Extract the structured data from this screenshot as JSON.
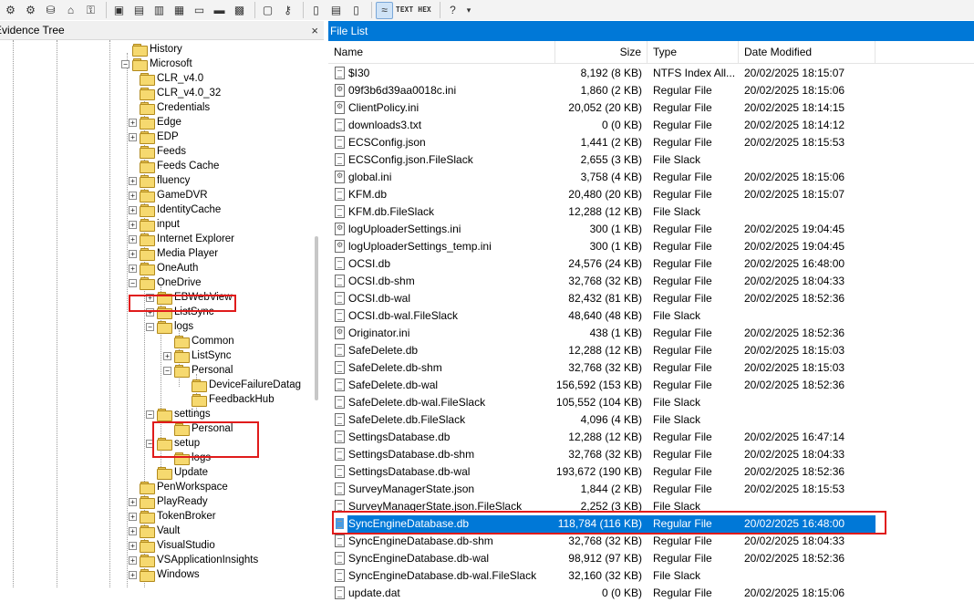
{
  "toolbar": {
    "buttons": [
      "add-evidence",
      "add-all-evidence",
      "create-disk-image",
      "export-files",
      "decrypt",
      "acquire",
      "save",
      "save-all",
      "capture-memory",
      "verify",
      "print",
      "options",
      "report",
      "find",
      "search",
      "new",
      "properties",
      "open",
      "view-natural",
      "view-text",
      "view-hex",
      "help",
      "more"
    ],
    "text_label": "TEXT",
    "hex_label": "HEX"
  },
  "evidence_tree": {
    "title": "Evidence Tree",
    "close": "×",
    "items": [
      {
        "label": "History",
        "level": 0,
        "exp": ""
      },
      {
        "label": "Microsoft",
        "level": 0,
        "exp": "-"
      },
      {
        "label": "CLR_v4.0",
        "level": 1,
        "exp": ""
      },
      {
        "label": "CLR_v4.0_32",
        "level": 1,
        "exp": ""
      },
      {
        "label": "Credentials",
        "level": 1,
        "exp": ""
      },
      {
        "label": "Edge",
        "level": 1,
        "exp": "+"
      },
      {
        "label": "EDP",
        "level": 1,
        "exp": "+"
      },
      {
        "label": "Feeds",
        "level": 1,
        "exp": ""
      },
      {
        "label": "Feeds Cache",
        "level": 1,
        "exp": ""
      },
      {
        "label": "fluency",
        "level": 1,
        "exp": "+"
      },
      {
        "label": "GameDVR",
        "level": 1,
        "exp": "+"
      },
      {
        "label": "IdentityCache",
        "level": 1,
        "exp": "+"
      },
      {
        "label": "input",
        "level": 1,
        "exp": "+"
      },
      {
        "label": "Internet Explorer",
        "level": 1,
        "exp": "+"
      },
      {
        "label": "Media Player",
        "level": 1,
        "exp": "+"
      },
      {
        "label": "OneAuth",
        "level": 1,
        "exp": "+"
      },
      {
        "label": "OneDrive",
        "level": 1,
        "exp": "-"
      },
      {
        "label": "EBWebView",
        "level": 2,
        "exp": "+"
      },
      {
        "label": "ListSync",
        "level": 2,
        "exp": "+"
      },
      {
        "label": "logs",
        "level": 2,
        "exp": "-"
      },
      {
        "label": "Common",
        "level": 3,
        "exp": ""
      },
      {
        "label": "ListSync",
        "level": 3,
        "exp": "+"
      },
      {
        "label": "Personal",
        "level": 3,
        "exp": "-"
      },
      {
        "label": "DeviceFailureDatag",
        "level": 4,
        "exp": ""
      },
      {
        "label": "FeedbackHub",
        "level": 4,
        "exp": ""
      },
      {
        "label": "settings",
        "level": 2,
        "exp": "-"
      },
      {
        "label": "Personal",
        "level": 3,
        "exp": ""
      },
      {
        "label": "setup",
        "level": 2,
        "exp": "-"
      },
      {
        "label": "logs",
        "level": 3,
        "exp": ""
      },
      {
        "label": "Update",
        "level": 2,
        "exp": ""
      },
      {
        "label": "PenWorkspace",
        "level": 1,
        "exp": ""
      },
      {
        "label": "PlayReady",
        "level": 1,
        "exp": "+"
      },
      {
        "label": "TokenBroker",
        "level": 1,
        "exp": "+"
      },
      {
        "label": "Vault",
        "level": 1,
        "exp": "+"
      },
      {
        "label": "VisualStudio",
        "level": 1,
        "exp": "+"
      },
      {
        "label": "VSApplicationInsights",
        "level": 1,
        "exp": "+"
      },
      {
        "label": "Windows",
        "level": 1,
        "exp": "+"
      }
    ]
  },
  "file_list": {
    "title": "File List",
    "columns": {
      "name": "Name",
      "size": "Size",
      "type": "Type",
      "date": "Date Modified"
    },
    "rows": [
      {
        "name": "$I30",
        "size": "8,192 (8 KB)",
        "type": "NTFS Index All...",
        "date": "20/02/2025 18:15:07",
        "icon": "file-icon"
      },
      {
        "name": "09f3b6d39aa0018c.ini",
        "size": "1,860 (2 KB)",
        "type": "Regular File",
        "date": "20/02/2025 18:15:06",
        "icon": "settings-file-icon"
      },
      {
        "name": "ClientPolicy.ini",
        "size": "20,052 (20 KB)",
        "type": "Regular File",
        "date": "20/02/2025 18:14:15",
        "icon": "settings-file-icon"
      },
      {
        "name": "downloads3.txt",
        "size": "0 (0 KB)",
        "type": "Regular File",
        "date": "20/02/2025 18:14:12",
        "icon": "text-file-icon"
      },
      {
        "name": "ECSConfig.json",
        "size": "1,441 (2 KB)",
        "type": "Regular File",
        "date": "20/02/2025 18:15:53",
        "icon": "file-icon"
      },
      {
        "name": "ECSConfig.json.FileSlack",
        "size": "2,655 (3 KB)",
        "type": "File Slack",
        "date": "",
        "icon": "file-icon"
      },
      {
        "name": "global.ini",
        "size": "3,758 (4 KB)",
        "type": "Regular File",
        "date": "20/02/2025 18:15:06",
        "icon": "settings-file-icon"
      },
      {
        "name": "KFM.db",
        "size": "20,480 (20 KB)",
        "type": "Regular File",
        "date": "20/02/2025 18:15:07",
        "icon": "database-file-icon"
      },
      {
        "name": "KFM.db.FileSlack",
        "size": "12,288 (12 KB)",
        "type": "File Slack",
        "date": "",
        "icon": "file-icon"
      },
      {
        "name": "logUploaderSettings.ini",
        "size": "300 (1 KB)",
        "type": "Regular File",
        "date": "20/02/2025 19:04:45",
        "icon": "settings-file-icon"
      },
      {
        "name": "logUploaderSettings_temp.ini",
        "size": "300 (1 KB)",
        "type": "Regular File",
        "date": "20/02/2025 19:04:45",
        "icon": "settings-file-icon"
      },
      {
        "name": "OCSI.db",
        "size": "24,576 (24 KB)",
        "type": "Regular File",
        "date": "20/02/2025 16:48:00",
        "icon": "database-file-icon"
      },
      {
        "name": "OCSI.db-shm",
        "size": "32,768 (32 KB)",
        "type": "Regular File",
        "date": "20/02/2025 18:04:33",
        "icon": "file-icon"
      },
      {
        "name": "OCSI.db-wal",
        "size": "82,432 (81 KB)",
        "type": "Regular File",
        "date": "20/02/2025 18:52:36",
        "icon": "file-icon"
      },
      {
        "name": "OCSI.db-wal.FileSlack",
        "size": "48,640 (48 KB)",
        "type": "File Slack",
        "date": "",
        "icon": "file-icon"
      },
      {
        "name": "Originator.ini",
        "size": "438 (1 KB)",
        "type": "Regular File",
        "date": "20/02/2025 18:52:36",
        "icon": "settings-file-icon"
      },
      {
        "name": "SafeDelete.db",
        "size": "12,288 (12 KB)",
        "type": "Regular File",
        "date": "20/02/2025 18:15:03",
        "icon": "file-icon"
      },
      {
        "name": "SafeDelete.db-shm",
        "size": "32,768 (32 KB)",
        "type": "Regular File",
        "date": "20/02/2025 18:15:03",
        "icon": "file-icon"
      },
      {
        "name": "SafeDelete.db-wal",
        "size": "156,592 (153 KB)",
        "type": "Regular File",
        "date": "20/02/2025 18:52:36",
        "icon": "file-icon"
      },
      {
        "name": "SafeDelete.db-wal.FileSlack",
        "size": "105,552 (104 KB)",
        "type": "File Slack",
        "date": "",
        "icon": "file-icon"
      },
      {
        "name": "SafeDelete.db.FileSlack",
        "size": "4,096 (4 KB)",
        "type": "File Slack",
        "date": "",
        "icon": "file-icon"
      },
      {
        "name": "SettingsDatabase.db",
        "size": "12,288 (12 KB)",
        "type": "Regular File",
        "date": "20/02/2025 16:47:14",
        "icon": "database-file-icon"
      },
      {
        "name": "SettingsDatabase.db-shm",
        "size": "32,768 (32 KB)",
        "type": "Regular File",
        "date": "20/02/2025 18:04:33",
        "icon": "file-icon"
      },
      {
        "name": "SettingsDatabase.db-wal",
        "size": "193,672 (190 KB)",
        "type": "Regular File",
        "date": "20/02/2025 18:52:36",
        "icon": "file-icon"
      },
      {
        "name": "SurveyManagerState.json",
        "size": "1,844 (2 KB)",
        "type": "Regular File",
        "date": "20/02/2025 18:15:53",
        "icon": "file-icon"
      },
      {
        "name": "SurveyManagerState.json.FileSlack",
        "size": "2,252 (3 KB)",
        "type": "File Slack",
        "date": "",
        "icon": "file-icon"
      },
      {
        "name": "SyncEngineDatabase.db",
        "size": "118,784 (116 KB)",
        "type": "Regular File",
        "date": "20/02/2025 16:48:00",
        "icon": "database-file-icon",
        "selected": true
      },
      {
        "name": "SyncEngineDatabase.db-shm",
        "size": "32,768 (32 KB)",
        "type": "Regular File",
        "date": "20/02/2025 18:04:33",
        "icon": "file-icon"
      },
      {
        "name": "SyncEngineDatabase.db-wal",
        "size": "98,912 (97 KB)",
        "type": "Regular File",
        "date": "20/02/2025 18:52:36",
        "icon": "file-icon"
      },
      {
        "name": "SyncEngineDatabase.db-wal.FileSlack",
        "size": "32,160 (32 KB)",
        "type": "File Slack",
        "date": "",
        "icon": "file-icon"
      },
      {
        "name": "update.dat",
        "size": "0 (0 KB)",
        "type": "Regular File",
        "date": "20/02/2025 18:15:06",
        "icon": "file-icon"
      }
    ]
  },
  "colors": {
    "accent": "#0078d7",
    "highlight_box": "#e01b1b",
    "folder": "#f6d96f"
  }
}
